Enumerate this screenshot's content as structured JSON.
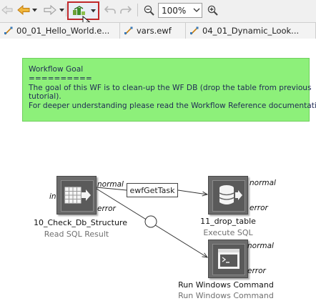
{
  "toolbar": {
    "buttons": [
      {
        "name": "back-disabled-icon"
      },
      {
        "name": "back-icon",
        "color": "#e39a1d"
      },
      {
        "name": "forward-icon"
      },
      {
        "name": "dropdown-icon"
      },
      {
        "name": "run-workflow-icon",
        "selected": true
      },
      {
        "name": "undo-icon"
      },
      {
        "name": "redo-icon"
      },
      {
        "name": "zoom-out-icon"
      },
      {
        "name": "zoom-in-icon"
      }
    ],
    "zoom_value": "100%"
  },
  "tabs": [
    {
      "label": "00_01_Hello_World.e...",
      "icon": "workflow-icon"
    },
    {
      "label": "vars.ewf",
      "icon": "workflow-icon"
    },
    {
      "label": "04_01_Dynamic_Look...",
      "icon": "workflow-icon"
    }
  ],
  "goal_note": {
    "lines": [
      "Workflow Goal",
      "==========",
      "The goal of this WF is to clean-up the WF DB (drop the table from previous",
      "tutorial).",
      "For deeper understanding please read the Workflow Reference documentation."
    ],
    "color": "#8df07a"
  },
  "nodes": [
    {
      "name": "10_Check_Db_Structure",
      "type": "Read SQL Result",
      "icon": "table-arrow-icon",
      "ports": {
        "in": "in",
        "normal": "normal",
        "error": "error"
      }
    },
    {
      "name": "11_drop_table",
      "type": "Execute SQL",
      "icon": "database-icon",
      "ports": {
        "normal": "normal",
        "error": "error"
      }
    },
    {
      "name": "Run Windows Command",
      "type": "Run Windows Command",
      "icon": "terminal-window-icon",
      "ports": {
        "normal": "normal",
        "error": "error"
      }
    }
  ],
  "variable_box": "ewfGetTask"
}
